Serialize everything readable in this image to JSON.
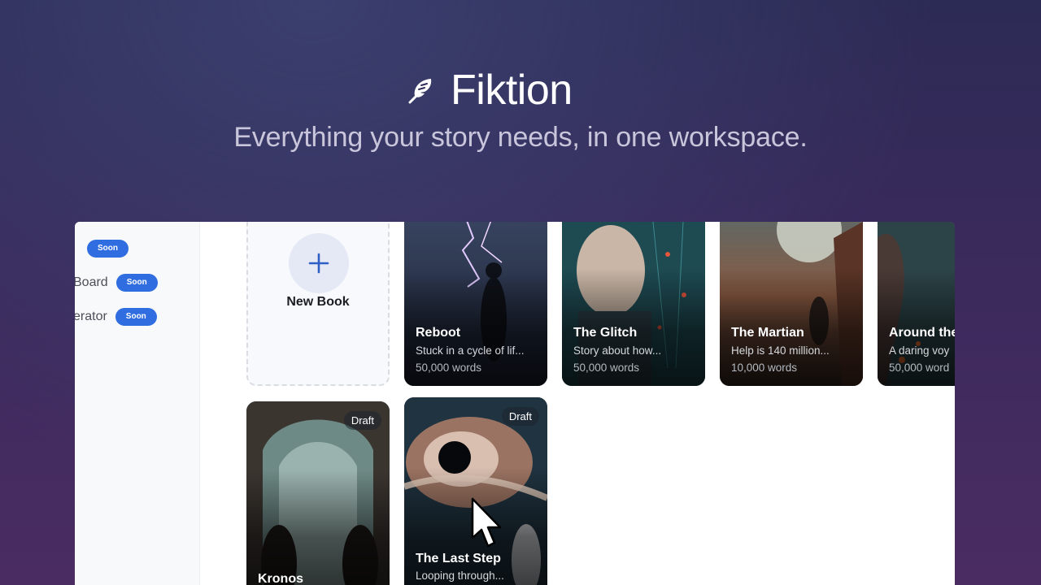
{
  "hero": {
    "brand_name": "Fiktion",
    "tagline": "Everything your story needs, in one workspace.",
    "brand_icon": "feather-icon"
  },
  "sidebar": {
    "items": [
      {
        "label": "",
        "badge": "Soon"
      },
      {
        "label": "Board",
        "badge": "Soon"
      },
      {
        "label": "erator",
        "badge": "Soon"
      }
    ]
  },
  "library": {
    "new_book_label": "New Book",
    "books": [
      {
        "title": "Reboot",
        "description": "Stuck in a cycle of lif...",
        "words": "50,000 words",
        "badge": ""
      },
      {
        "title": "The Glitch",
        "description": "Story about how...",
        "words": "50,000 words",
        "badge": ""
      },
      {
        "title": "The Martian",
        "description": "Help is 140 million...",
        "words": "10,000 words",
        "badge": ""
      },
      {
        "title": "Around the",
        "description": "A daring voy",
        "words": "50,000 word",
        "badge": ""
      },
      {
        "title": "Kronos",
        "description": "",
        "words": "",
        "badge": "Draft"
      },
      {
        "title": "The Last Step",
        "description": "Looping through...",
        "words": "",
        "badge": "Draft"
      }
    ]
  },
  "colors": {
    "accent": "#2f6de0",
    "background_top": "#2c2b55",
    "background_bottom": "#4a2c62"
  }
}
